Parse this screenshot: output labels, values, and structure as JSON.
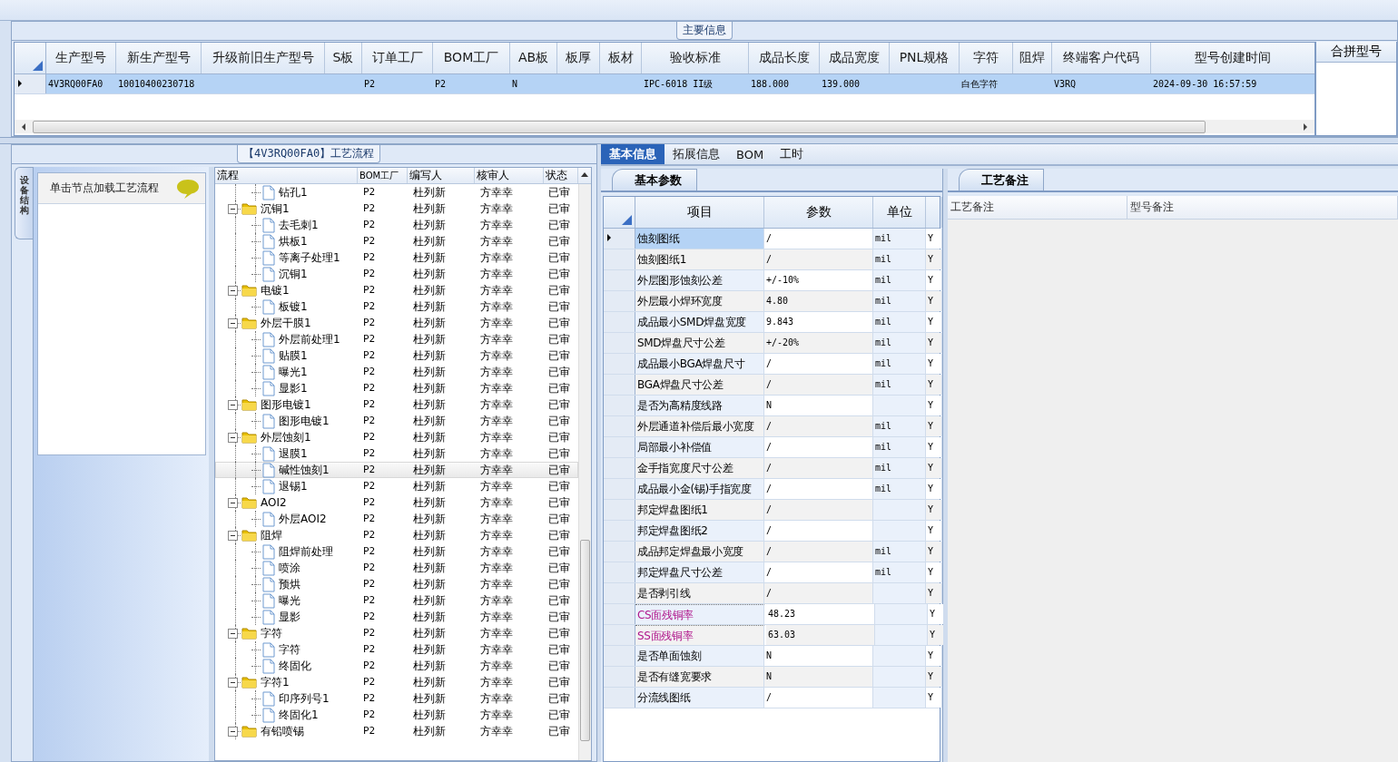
{
  "main_info": {
    "title": "主要信息",
    "columns": [
      "生产型号",
      "新生产型号",
      "升级前旧生产型号",
      "S板",
      "订单工厂",
      "BOM工厂",
      "AB板",
      "板厚",
      "板材",
      "验收标准",
      "成品长度",
      "成品宽度",
      "PNL规格",
      "字符",
      "阻焊",
      "终端客户代码",
      "型号创建时间"
    ],
    "rows": [
      {
        "selected": true,
        "cells": [
          "4V3RQ00FA0",
          "10010400230718",
          null,
          null,
          "P2",
          "P2",
          "N",
          null,
          null,
          "IPC-6018 II级",
          "188.000",
          "139.000",
          null,
          "白色字符",
          null,
          "V3RQ",
          "2024-09-30 16:57:59"
        ]
      }
    ],
    "side_panel": {
      "title": "合拼型号"
    }
  },
  "process": {
    "title": "【4V3RQ00FA0】工艺流程",
    "side_tab": "设备结构",
    "hint": "单击节点加载工艺流程",
    "tree": {
      "columns": [
        "流程",
        "BOM工厂",
        "编写人",
        "核审人",
        "状态"
      ],
      "continued_children": [
        {
          "label": "钻孔1",
          "kind": "file",
          "selected": false,
          "bom_factory": "P2",
          "writer": "杜列新",
          "reviewer": "方幸幸",
          "status": "已审"
        }
      ],
      "nodes": [
        {
          "label": "沉铜1",
          "kind": "folder",
          "expanded": true,
          "selected": false,
          "bom_factory": "P2",
          "writer": "杜列新",
          "reviewer": "方幸幸",
          "status": "已审",
          "children": [
            {
              "label": "去毛刺1",
              "kind": "file",
              "selected": false,
              "bom_factory": "P2",
              "writer": "杜列新",
              "reviewer": "方幸幸",
              "status": "已审"
            },
            {
              "label": "烘板1",
              "kind": "file",
              "selected": false,
              "bom_factory": "P2",
              "writer": "杜列新",
              "reviewer": "方幸幸",
              "status": "已审"
            },
            {
              "label": "等离子处理1",
              "kind": "file",
              "selected": false,
              "bom_factory": "P2",
              "writer": "杜列新",
              "reviewer": "方幸幸",
              "status": "已审"
            },
            {
              "label": "沉铜1",
              "kind": "file",
              "selected": false,
              "bom_factory": "P2",
              "writer": "杜列新",
              "reviewer": "方幸幸",
              "status": "已审"
            }
          ]
        },
        {
          "label": "电镀1",
          "kind": "folder",
          "expanded": true,
          "selected": false,
          "bom_factory": "P2",
          "writer": "杜列新",
          "reviewer": "方幸幸",
          "status": "已审",
          "children": [
            {
              "label": "板镀1",
              "kind": "file",
              "selected": false,
              "bom_factory": "P2",
              "writer": "杜列新",
              "reviewer": "方幸幸",
              "status": "已审"
            }
          ]
        },
        {
          "label": "外层干膜1",
          "kind": "folder",
          "expanded": true,
          "selected": false,
          "bom_factory": "P2",
          "writer": "杜列新",
          "reviewer": "方幸幸",
          "status": "已审",
          "children": [
            {
              "label": "外层前处理1",
              "kind": "file",
              "selected": false,
              "bom_factory": "P2",
              "writer": "杜列新",
              "reviewer": "方幸幸",
              "status": "已审"
            },
            {
              "label": "贴膜1",
              "kind": "file",
              "selected": false,
              "bom_factory": "P2",
              "writer": "杜列新",
              "reviewer": "方幸幸",
              "status": "已审"
            },
            {
              "label": "曝光1",
              "kind": "file",
              "selected": false,
              "bom_factory": "P2",
              "writer": "杜列新",
              "reviewer": "方幸幸",
              "status": "已审"
            },
            {
              "label": "显影1",
              "kind": "file",
              "selected": false,
              "bom_factory": "P2",
              "writer": "杜列新",
              "reviewer": "方幸幸",
              "status": "已审"
            }
          ]
        },
        {
          "label": "图形电镀1",
          "kind": "folder",
          "expanded": true,
          "selected": false,
          "bom_factory": "P2",
          "writer": "杜列新",
          "reviewer": "方幸幸",
          "status": "已审",
          "children": [
            {
              "label": "图形电镀1",
              "kind": "file",
              "selected": false,
              "bom_factory": "P2",
              "writer": "杜列新",
              "reviewer": "方幸幸",
              "status": "已审"
            }
          ]
        },
        {
          "label": "外层蚀刻1",
          "kind": "folder",
          "expanded": true,
          "selected": false,
          "bom_factory": "P2",
          "writer": "杜列新",
          "reviewer": "方幸幸",
          "status": "已审",
          "children": [
            {
              "label": "退膜1",
              "kind": "file",
              "selected": false,
              "bom_factory": "P2",
              "writer": "杜列新",
              "reviewer": "方幸幸",
              "status": "已审"
            },
            {
              "label": "碱性蚀刻1",
              "kind": "file",
              "selected": true,
              "bom_factory": "P2",
              "writer": "杜列新",
              "reviewer": "方幸幸",
              "status": "已审"
            },
            {
              "label": "退锡1",
              "kind": "file",
              "selected": false,
              "bom_factory": "P2",
              "writer": "杜列新",
              "reviewer": "方幸幸",
              "status": "已审"
            }
          ]
        },
        {
          "label": "AOI2",
          "kind": "folder",
          "expanded": true,
          "selected": false,
          "bom_factory": "P2",
          "writer": "杜列新",
          "reviewer": "方幸幸",
          "status": "已审",
          "children": [
            {
              "label": "外层AOI2",
              "kind": "file",
              "selected": false,
              "bom_factory": "P2",
              "writer": "杜列新",
              "reviewer": "方幸幸",
              "status": "已审"
            }
          ]
        },
        {
          "label": "阻焊",
          "kind": "folder",
          "expanded": true,
          "selected": false,
          "bom_factory": "P2",
          "writer": "杜列新",
          "reviewer": "方幸幸",
          "status": "已审",
          "children": [
            {
              "label": "阻焊前处理",
              "kind": "file",
              "selected": false,
              "bom_factory": "P2",
              "writer": "杜列新",
              "reviewer": "方幸幸",
              "status": "已审"
            },
            {
              "label": "喷涂",
              "kind": "file",
              "selected": false,
              "bom_factory": "P2",
              "writer": "杜列新",
              "reviewer": "方幸幸",
              "status": "已审"
            },
            {
              "label": "预烘",
              "kind": "file",
              "selected": false,
              "bom_factory": "P2",
              "writer": "杜列新",
              "reviewer": "方幸幸",
              "status": "已审"
            },
            {
              "label": "曝光",
              "kind": "file",
              "selected": false,
              "bom_factory": "P2",
              "writer": "杜列新",
              "reviewer": "方幸幸",
              "status": "已审"
            },
            {
              "label": "显影",
              "kind": "file",
              "selected": false,
              "bom_factory": "P2",
              "writer": "杜列新",
              "reviewer": "方幸幸",
              "status": "已审"
            }
          ]
        },
        {
          "label": "字符",
          "kind": "folder",
          "expanded": true,
          "selected": false,
          "bom_factory": "P2",
          "writer": "杜列新",
          "reviewer": "方幸幸",
          "status": "已审",
          "children": [
            {
              "label": "字符",
              "kind": "file",
              "selected": false,
              "bom_factory": "P2",
              "writer": "杜列新",
              "reviewer": "方幸幸",
              "status": "已审"
            },
            {
              "label": "终固化",
              "kind": "file",
              "selected": false,
              "bom_factory": "P2",
              "writer": "杜列新",
              "reviewer": "方幸幸",
              "status": "已审"
            }
          ]
        },
        {
          "label": "字符1",
          "kind": "folder",
          "expanded": true,
          "selected": false,
          "bom_factory": "P2",
          "writer": "杜列新",
          "reviewer": "方幸幸",
          "status": "已审",
          "children": [
            {
              "label": "印序列号1",
              "kind": "file",
              "selected": false,
              "bom_factory": "P2",
              "writer": "杜列新",
              "reviewer": "方幸幸",
              "status": "已审"
            },
            {
              "label": "终固化1",
              "kind": "file",
              "selected": false,
              "bom_factory": "P2",
              "writer": "杜列新",
              "reviewer": "方幸幸",
              "status": "已审"
            }
          ]
        },
        {
          "label": "有铅喷锡",
          "kind": "folder",
          "expanded": true,
          "selected": false,
          "bom_factory": "P2",
          "writer": "杜列新",
          "reviewer": "方幸幸",
          "status": "已审"
        }
      ]
    }
  },
  "detail": {
    "tabs": [
      {
        "label": "基本信息",
        "selected": true
      },
      {
        "label": "拓展信息",
        "selected": false
      },
      {
        "label": "BOM",
        "selected": false
      },
      {
        "label": "工时",
        "selected": false
      }
    ],
    "params": {
      "title": "基本参数",
      "columns": [
        "项目",
        "参数",
        "单位"
      ],
      "rows": [
        {
          "item": "蚀刻图纸",
          "value": "/",
          "unit": "mil",
          "column_4": "Y",
          "selected": true,
          "highlighted": false
        },
        {
          "item": "蚀刻图纸1",
          "value": "/",
          "unit": "mil",
          "column_4": "Y",
          "selected": false,
          "highlighted": false
        },
        {
          "item": "外层图形蚀刻公差",
          "value": "+/-10%",
          "unit": "mil",
          "column_4": "Y",
          "selected": false,
          "highlighted": false
        },
        {
          "item": "外层最小焊环宽度",
          "value": "4.80",
          "unit": "mil",
          "column_4": "Y",
          "selected": false,
          "highlighted": false
        },
        {
          "item": "成品最小SMD焊盘宽度",
          "value": "9.843",
          "unit": "mil",
          "column_4": "Y",
          "selected": false,
          "highlighted": false
        },
        {
          "item": "SMD焊盘尺寸公差",
          "value": "+/-20%",
          "unit": "mil",
          "column_4": "Y",
          "selected": false,
          "highlighted": false
        },
        {
          "item": "成品最小BGA焊盘尺寸",
          "value": "/",
          "unit": "mil",
          "column_4": "Y",
          "selected": false,
          "highlighted": false
        },
        {
          "item": "BGA焊盘尺寸公差",
          "value": "/",
          "unit": "mil",
          "column_4": "Y",
          "selected": false,
          "highlighted": false
        },
        {
          "item": "是否为高精度线路",
          "value": "N",
          "column_4": "Y",
          "selected": false,
          "highlighted": false
        },
        {
          "item": "外层通道补偿后最小宽度",
          "value": "/",
          "unit": "mil",
          "column_4": "Y",
          "selected": false,
          "highlighted": false
        },
        {
          "item": "局部最小补偿值",
          "value": "/",
          "unit": "mil",
          "column_4": "Y",
          "selected": false,
          "highlighted": false
        },
        {
          "item": "金手指宽度尺寸公差",
          "value": "/",
          "unit": "mil",
          "column_4": "Y",
          "selected": false,
          "highlighted": false
        },
        {
          "item": "成品最小金(锡)手指宽度",
          "value": "/",
          "unit": "mil",
          "column_4": "Y",
          "selected": false,
          "highlighted": false
        },
        {
          "item": "邦定焊盘图纸1",
          "value": "/",
          "column_4": "Y",
          "selected": false,
          "highlighted": false
        },
        {
          "item": "邦定焊盘图纸2",
          "value": "/",
          "column_4": "Y",
          "selected": false,
          "highlighted": false
        },
        {
          "item": "成品邦定焊盘最小宽度",
          "value": "/",
          "unit": "mil",
          "column_4": "Y",
          "selected": false,
          "highlighted": false
        },
        {
          "item": "邦定焊盘尺寸公差",
          "value": "/",
          "unit": "mil",
          "column_4": "Y",
          "selected": false,
          "highlighted": false
        },
        {
          "item": "是否剥引线",
          "value": "/",
          "column_4": "Y",
          "selected": false,
          "highlighted": false
        },
        {
          "item": "CS面残铜率",
          "value": "48.23",
          "column_4": "Y",
          "selected": false,
          "highlighted": true
        },
        {
          "item": "SS面残铜率",
          "value": "63.03",
          "column_4": "Y",
          "selected": false,
          "highlighted": true
        },
        {
          "item": "是否单面蚀刻",
          "value": "N",
          "column_4": "Y",
          "selected": false,
          "highlighted": false
        },
        {
          "item": "是否有缝宽要求",
          "value": "N",
          "column_4": "Y",
          "selected": false,
          "highlighted": false
        },
        {
          "item": "分流线图纸",
          "value": "/",
          "column_4": "Y",
          "selected": false,
          "highlighted": false
        }
      ]
    },
    "notes": {
      "title": "工艺备注",
      "columns": [
        "工艺备注",
        "型号备注"
      ]
    }
  }
}
